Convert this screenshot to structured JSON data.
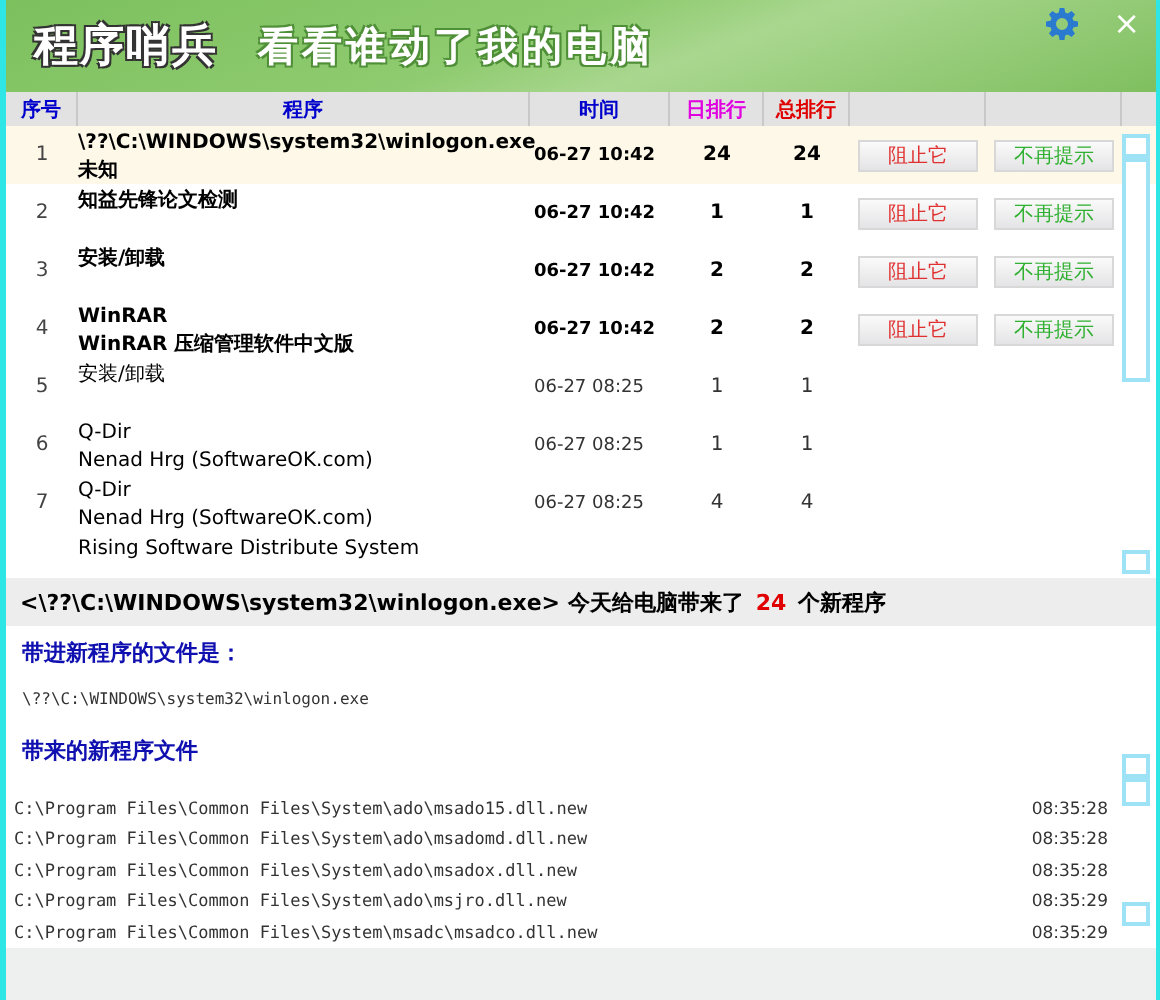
{
  "header": {
    "title": "程序哨兵",
    "slogan": "看看谁动了我的电脑",
    "close": "×"
  },
  "table": {
    "columns": [
      "序号",
      "程序",
      "时间",
      "日排行",
      "总排行"
    ],
    "rows": [
      {
        "index": "1",
        "name": "\\??\\C:\\WINDOWS\\system32\\winlogon.exe",
        "publisher": "未知",
        "time": "06-27 10:42",
        "day_rank": "24",
        "total_rank": "24",
        "new": true,
        "selected": true,
        "actions": [
          "阻止它",
          "不再提示"
        ]
      },
      {
        "index": "2",
        "name": "知益先锋论文检测",
        "time": "06-27 10:42",
        "day_rank": "1",
        "total_rank": "1",
        "new": true,
        "selected": false,
        "actions": [
          "阻止它",
          "不再提示"
        ]
      },
      {
        "index": "3",
        "name": "安装/卸载",
        "time": "06-27 10:42",
        "day_rank": "2",
        "total_rank": "2",
        "new": true,
        "selected": false,
        "actions": [
          "阻止它",
          "不再提示"
        ]
      },
      {
        "index": "4",
        "name": "WinRAR",
        "publisher": "WinRAR 压缩管理软件中文版",
        "time": "06-27 10:42",
        "day_rank": "2",
        "total_rank": "2",
        "new": true,
        "selected": false,
        "actions": [
          "阻止它",
          "不再提示"
        ]
      },
      {
        "index": "5",
        "name": "安装/卸载",
        "time": "06-27 08:25",
        "day_rank": "1",
        "total_rank": "1",
        "new": false,
        "selected": false
      },
      {
        "index": "6",
        "name": "Q-Dir",
        "publisher": "Nenad Hrg (SoftwareOK.com)",
        "time": "06-27 08:25",
        "day_rank": "1",
        "total_rank": "1",
        "new": false,
        "selected": false
      },
      {
        "index": "7",
        "name": "Q-Dir",
        "publisher": "Nenad Hrg (SoftwareOK.com)",
        "time": "06-27 08:25",
        "day_rank": "4",
        "total_rank": "4",
        "new": false,
        "selected": false
      },
      {
        "name": "Rising Software Distribute System",
        "new": false,
        "selected": false
      }
    ]
  },
  "summary": {
    "text": "<\\??\\C:\\WINDOWS\\system32\\winlogon.exe> 今天给电脑带来了",
    "count": "24",
    "suffix": "个新程序"
  },
  "detail": {
    "source_heading": "带进新程序的文件是：",
    "source": "\\??\\C:\\WINDOWS\\system32\\winlogon.exe",
    "files_heading": "带来的新程序文件",
    "files": [
      {
        "path": "C:\\Program Files\\Common Files\\System\\ado\\msado15.dll.new",
        "time": "08:35:28"
      },
      {
        "path": "C:\\Program Files\\Common Files\\System\\ado\\msadomd.dll.new",
        "time": "08:35:28"
      },
      {
        "path": "C:\\Program Files\\Common Files\\System\\ado\\msadox.dll.new",
        "time": "08:35:28"
      },
      {
        "path": "C:\\Program Files\\Common Files\\System\\ado\\msjro.dll.new",
        "time": "08:35:29"
      },
      {
        "path": "C:\\Program Files\\Common Files\\System\\msadc\\msadco.dll.new",
        "time": "08:35:29"
      }
    ]
  }
}
